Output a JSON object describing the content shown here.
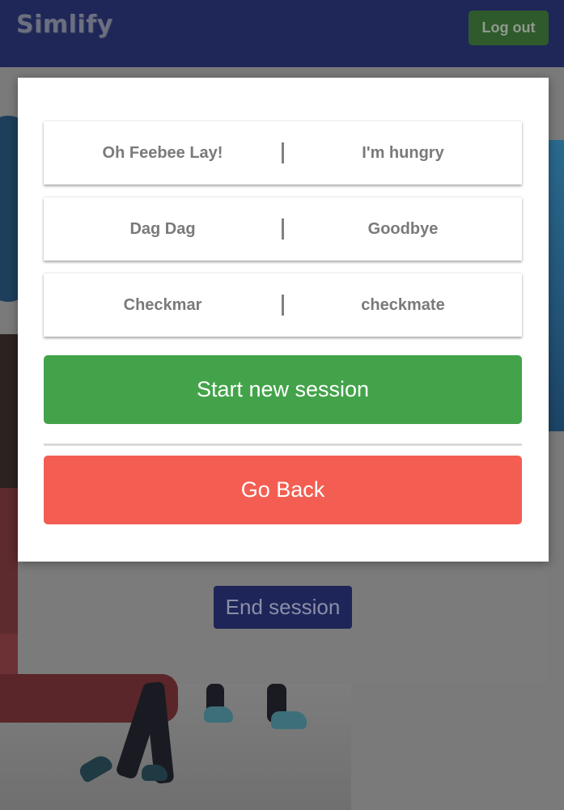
{
  "header": {
    "logo": "Simlify",
    "logout_label": "Log out"
  },
  "background": {
    "end_session_label": "End session"
  },
  "modal": {
    "phrases": [
      {
        "original": "Oh Feebee Lay!",
        "translation": "I'm hungry"
      },
      {
        "original": "Dag Dag",
        "translation": "Goodbye"
      },
      {
        "original": "Checkmar",
        "translation": "checkmate"
      }
    ],
    "start_label": "Start new session",
    "back_label": "Go Back"
  },
  "colors": {
    "header_bg": "#1f2758",
    "start_green": "#43a34a",
    "back_red": "#f45e52",
    "logout_green": "#2f5a2c",
    "end_session_navy": "#1e2559"
  }
}
